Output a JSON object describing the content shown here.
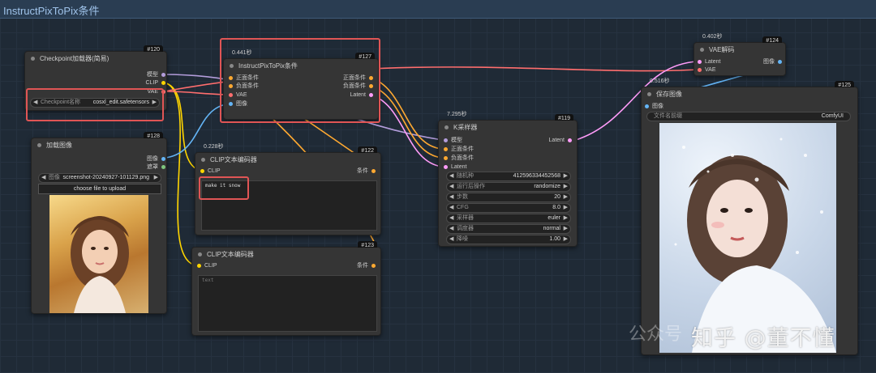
{
  "group": {
    "title": "InstructPixToPix条件"
  },
  "nodes": {
    "checkpoint": {
      "id": "#120",
      "title": "Checkpoint加载器(简易)",
      "outputs": [
        "模型",
        "CLIP",
        "VAE"
      ],
      "widget_label": "Checkpoint名称",
      "widget_value": "cosxl_edit.safetensors"
    },
    "load_image": {
      "id": "#128",
      "title": "加载图像",
      "outputs": [
        "图像",
        "遮罩"
      ],
      "widget_label": "图像",
      "widget_value": "screenshot-20240927-101129.png",
      "upload_label": "choose file to upload"
    },
    "ip2p": {
      "id": "#127",
      "time": "0.441秒",
      "title": "InstructPixToPix条件",
      "inputs": [
        "正面条件",
        "负面条件",
        "VAE",
        "图像"
      ],
      "outputs": [
        "正面条件",
        "负面条件",
        "Latent"
      ]
    },
    "clip_pos": {
      "id": "#122",
      "time": "0.228秒",
      "title": "CLIP文本编码器",
      "input": "CLIP",
      "output": "条件",
      "text": "make it snow"
    },
    "clip_neg": {
      "id": "#123",
      "title": "CLIP文本编码器",
      "input": "CLIP",
      "output": "条件",
      "text": "text"
    },
    "ksampler": {
      "id": "#119",
      "time": "7.295秒",
      "title": "K采样器",
      "inputs": [
        "模型",
        "正面条件",
        "负面条件",
        "Latent"
      ],
      "output": "Latent",
      "widgets": [
        {
          "label": "随机种",
          "value": "412596334452568"
        },
        {
          "label": "运行后操作",
          "value": "randomize"
        },
        {
          "label": "步数",
          "value": "20"
        },
        {
          "label": "CFG",
          "value": "8.0"
        },
        {
          "label": "采样器",
          "value": "euler"
        },
        {
          "label": "调度器",
          "value": "normal"
        },
        {
          "label": "降噪",
          "value": "1.00"
        }
      ]
    },
    "vae_decode": {
      "id": "#124",
      "time": "0.402秒",
      "title": "VAE解码",
      "inputs": [
        "Latent",
        "VAE"
      ],
      "output": "图像"
    },
    "save_image": {
      "id": "#125",
      "time": "0.516秒",
      "title": "保存图像",
      "input": "图像",
      "widget_label": "文件名前缀",
      "widget_value": "ComfyUI"
    }
  },
  "watermark": {
    "text": "知乎 @董不懂",
    "ghost": "公众号"
  },
  "colors": {
    "model": "#b39ddb",
    "clip": "#ffd500",
    "vae": "#ff6e6e",
    "conditioning": "#ffa931",
    "latent": "#ff9cf9",
    "image": "#64b5f6",
    "highlight": "#e05555"
  }
}
